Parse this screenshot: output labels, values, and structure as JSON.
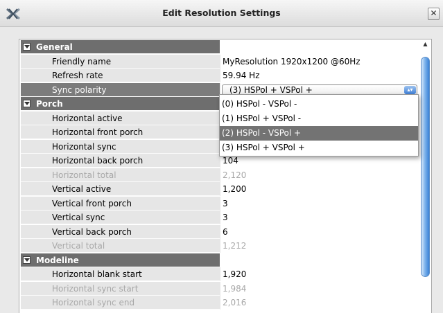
{
  "window": {
    "title": "Edit Resolution Settings",
    "close_glyph": "✕",
    "app_icon": "x-logo-icon"
  },
  "colors": {
    "section_header": "#6e6e6e",
    "selected_row": "#7c7c7c",
    "highlight_option": "#737373",
    "scrollbar": "#3a82d6"
  },
  "sections": {
    "general": {
      "label": "General",
      "friendly_name": {
        "label": "Friendly name",
        "value": "MyResolution 1920x1200 @60Hz"
      },
      "refresh_rate": {
        "label": "Refresh rate",
        "value": "59.94 Hz"
      },
      "sync_polarity": {
        "label": "Sync polarity",
        "value": "(3) HSPol +  VSPol +"
      }
    },
    "porch": {
      "label": "Porch",
      "rows": [
        {
          "label": "Horizontal active",
          "value": ""
        },
        {
          "label": "Horizontal front porch",
          "value": ""
        },
        {
          "label": "Horizontal sync",
          "value": ""
        },
        {
          "label": "Horizontal back porch",
          "value": "104"
        },
        {
          "label": "Horizontal total",
          "value": "2,120"
        },
        {
          "label": "Vertical active",
          "value": "1,200"
        },
        {
          "label": "Vertical front porch",
          "value": "3"
        },
        {
          "label": "Vertical sync",
          "value": "3"
        },
        {
          "label": "Vertical back porch",
          "value": "6"
        },
        {
          "label": "Vertical total",
          "value": "1,212"
        }
      ]
    },
    "modeline": {
      "label": "Modeline",
      "rows": [
        {
          "label": "Horizontal blank start",
          "value": "1,920"
        },
        {
          "label": "Horizontal sync start",
          "value": "1,984"
        },
        {
          "label": "Horizontal sync end",
          "value": "2,016"
        }
      ]
    }
  },
  "dropdown": {
    "options": [
      "(0) HSPol -  VSPol -",
      "(1) HSPol +  VSPol -",
      "(2) HSPol -  VSPol +",
      "(3) HSPol +  VSPol +"
    ],
    "highlighted_index": 2
  }
}
